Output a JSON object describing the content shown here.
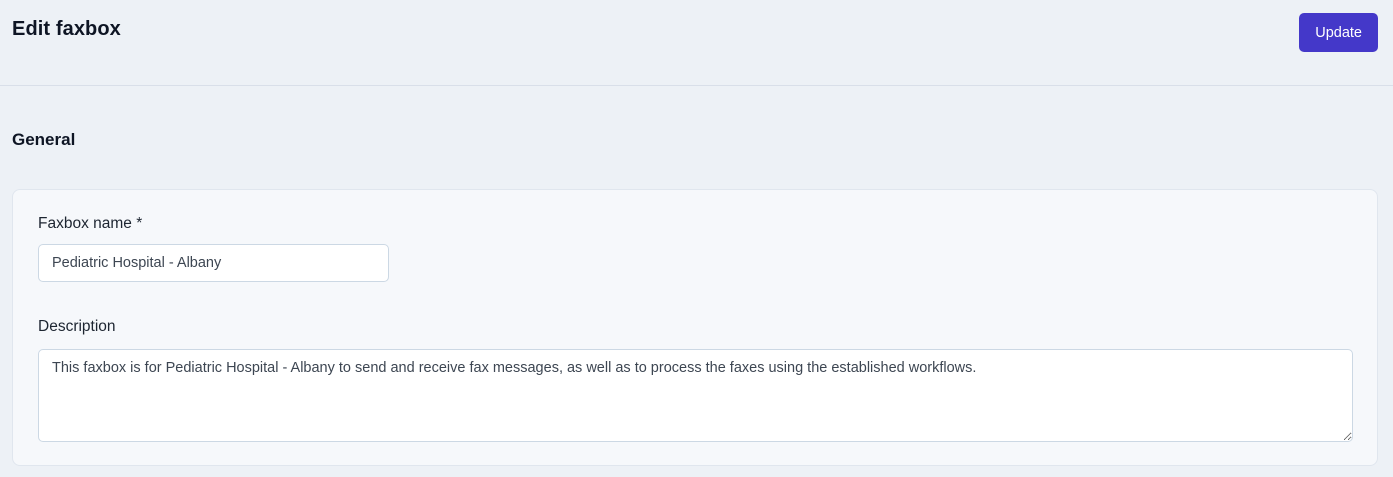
{
  "header": {
    "title": "Edit faxbox",
    "update_button_label": "Update"
  },
  "general_section": {
    "heading": "General",
    "fields": {
      "faxbox_name": {
        "label": "Faxbox name *",
        "value": "Pediatric Hospital - Albany"
      },
      "description": {
        "label": "Description",
        "value": "This faxbox is for Pediatric Hospital - Albany to send and receive fax messages, as well as to process the faxes using the established workflows."
      }
    }
  },
  "colors": {
    "accent": "#4438c9",
    "page_background": "#edf1f6",
    "panel_background": "#f6f8fb"
  }
}
